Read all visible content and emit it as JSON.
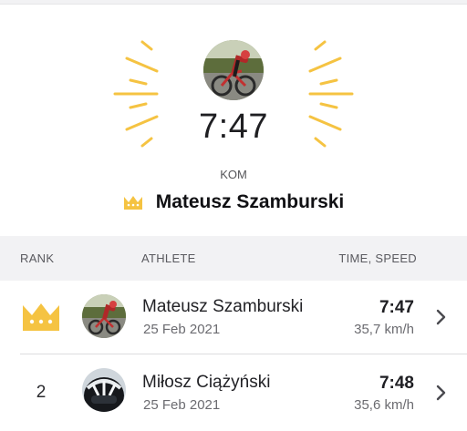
{
  "colors": {
    "accent_gold": "#F5C342",
    "header_bg": "#F2F2F4",
    "text_primary": "#1F1F22",
    "text_secondary": "#6B6B70"
  },
  "hero": {
    "time": "7:47",
    "label": "KOM",
    "leader_name": "Mateusz Szamburski",
    "leader_icon": "crown-icon",
    "avatar": "cyclist-photo"
  },
  "table": {
    "headers": {
      "rank": "RANK",
      "athlete": "ATHLETE",
      "time_speed": "TIME, SPEED"
    },
    "rows": [
      {
        "rank": "",
        "rank_icon": "crown-icon",
        "name": "Mateusz Szamburski",
        "date": "25 Feb 2021",
        "time": "7:47",
        "speed": "35,7 km/h",
        "avatar": "cyclist-photo",
        "action_icon": "chevron-right-icon"
      },
      {
        "rank": "2",
        "name": "Miłosz Ciążyński",
        "date": "25 Feb 2021",
        "time": "7:48",
        "speed": "35,6 km/h",
        "avatar": "helmet-photo",
        "action_icon": "chevron-right-icon"
      }
    ]
  }
}
